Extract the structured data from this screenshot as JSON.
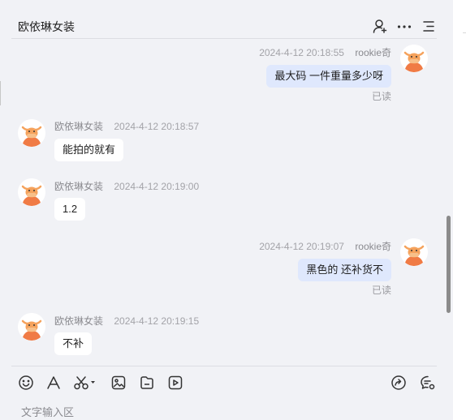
{
  "header": {
    "title": "欧依琳女装",
    "icons": [
      "add-user-icon",
      "more-icon",
      "list-menu-icon"
    ]
  },
  "messages": [
    {
      "direction": "out",
      "name": "rookie奇",
      "time": "2024-4-12 20:18:55",
      "text": "最大码  一件重量多少呀",
      "status": "已读"
    },
    {
      "direction": "in",
      "name": "欧依琳女装",
      "time": "2024-4-12 20:18:57",
      "text": "能拍的就有"
    },
    {
      "direction": "in",
      "name": "欧依琳女装",
      "time": "2024-4-12 20:19:00",
      "text": "1.2"
    },
    {
      "direction": "out",
      "name": "rookie奇",
      "time": "2024-4-12 20:19:07",
      "text": "黑色的  还补货不",
      "status": "已读"
    },
    {
      "direction": "in",
      "name": "欧依琳女装",
      "time": "2024-4-12 20:19:15",
      "text": "不补"
    }
  ],
  "toolbar": {
    "icons": [
      "emoji-icon",
      "font-icon",
      "scissors-icon",
      "image-icon",
      "file-icon",
      "video-icon",
      "share-icon",
      "chat-settings-icon"
    ],
    "input_placeholder": "文字输入区"
  },
  "colors": {
    "panel_bg": "#f1f2f6",
    "outgoing_bubble": "#dfe8fd",
    "incoming_bubble": "#ffffff",
    "avatar_accent": "#f08a4b"
  }
}
